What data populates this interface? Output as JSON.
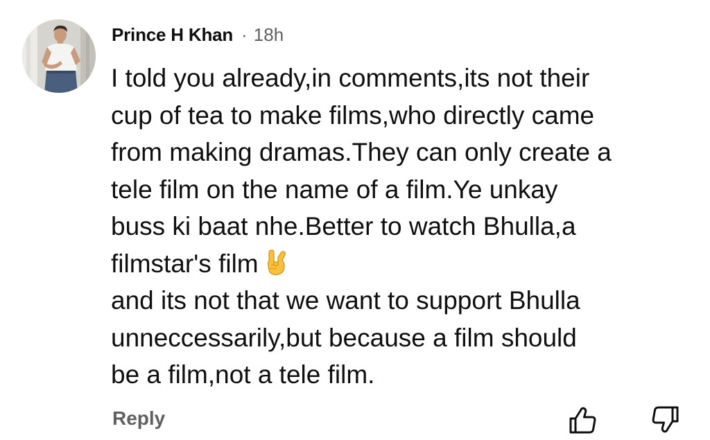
{
  "comment": {
    "author": "Prince H Khan",
    "separator": "·",
    "time": "18h",
    "lines": [
      "I told you already,in comments,its not their",
      "cup of tea to make films,who directly came",
      "from making dramas.They can only create a",
      "tele film on the name of a film.Ye unkay",
      "buss ki baat nhe.Better to watch Bhulla,a",
      "filmstar's film",
      "and its not that we want to support Bhulla",
      "unneccessarily,but because a film should",
      "be a film,not a tele film."
    ],
    "emoji": "sign-of-the-horns-icon"
  },
  "actions": {
    "reply_label": "Reply",
    "like_icon": "thumbs-up-icon",
    "dislike_icon": "thumbs-down-icon"
  },
  "colors": {
    "text": "#0f0f0f",
    "secondary": "#606060",
    "background": "#ffffff"
  }
}
